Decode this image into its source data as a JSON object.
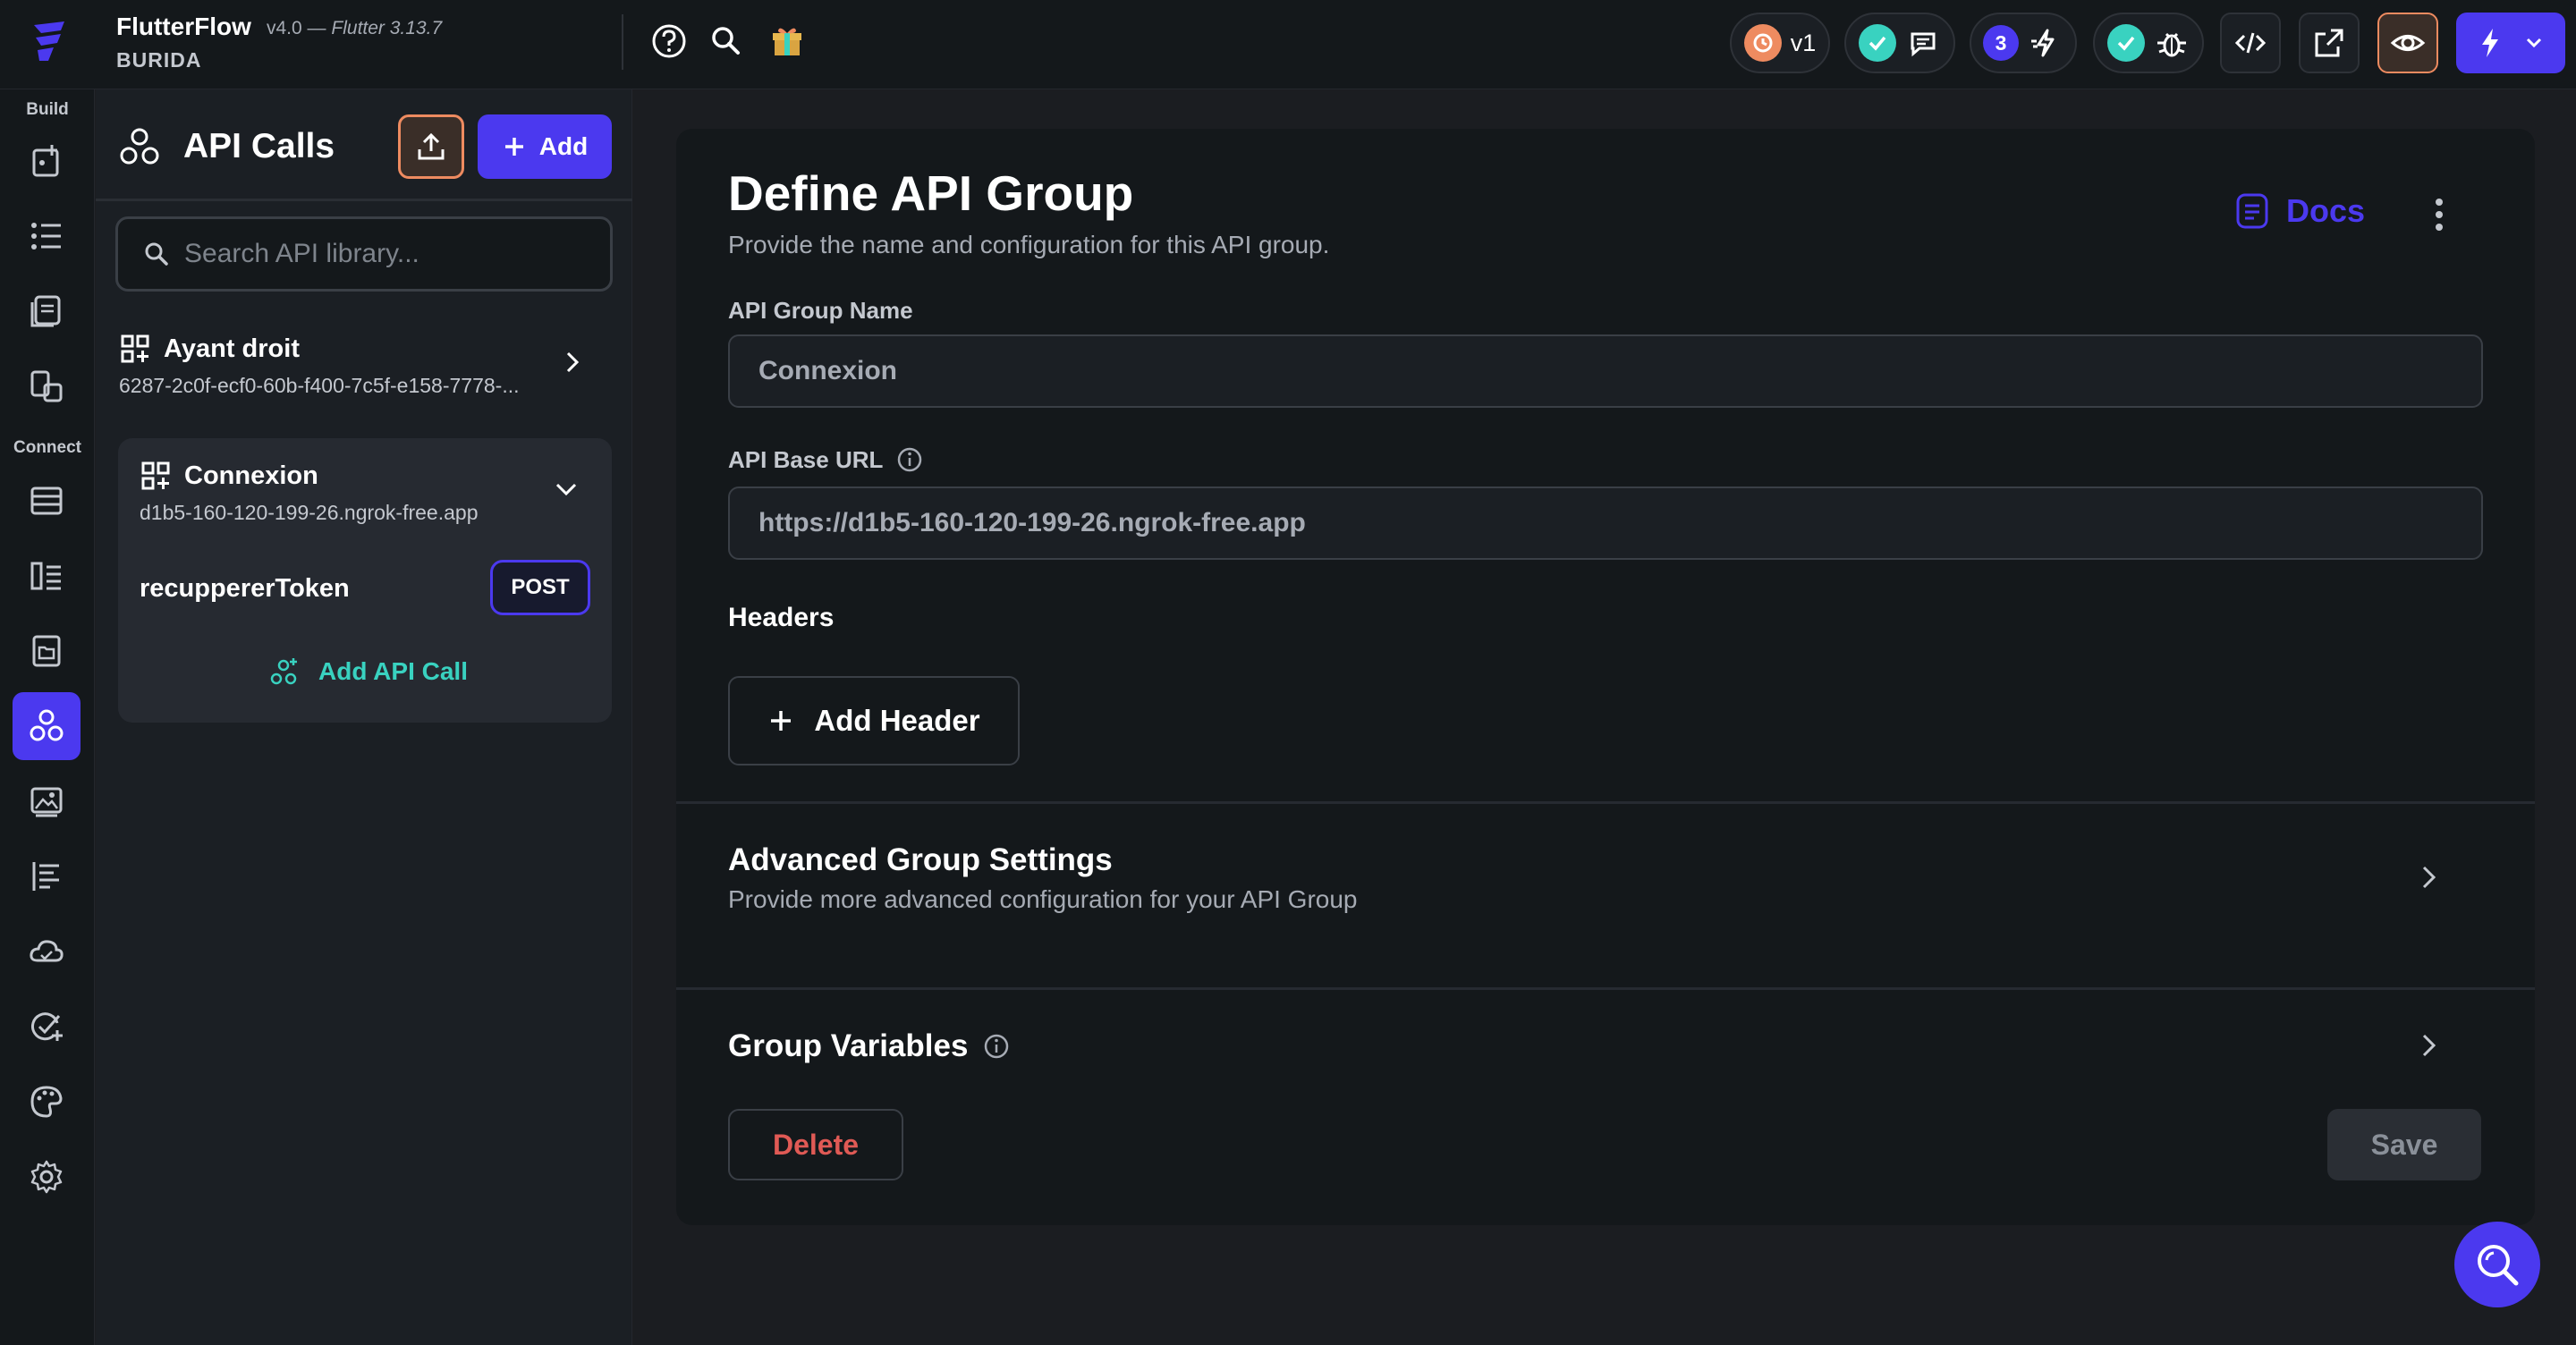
{
  "app": {
    "name": "FlutterFlow",
    "version": "v4.0",
    "version_separator": "—",
    "flutter_version": "Flutter 3.13.7",
    "project_name": "BURIDA"
  },
  "topbar": {
    "branch_label": "v1",
    "notification_count": "3",
    "icons": [
      "help-icon",
      "search-icon",
      "gift-icon",
      "history-icon",
      "check-icon",
      "comment-icon",
      "flash-icon",
      "bug-icon",
      "code-icon",
      "external-link-icon",
      "eye-icon",
      "bolt-icon",
      "chevron-down-icon"
    ]
  },
  "rail": {
    "build_label": "Build",
    "connect_label": "Connect"
  },
  "sidebar": {
    "title": "API Calls",
    "add_label": "Add",
    "search_placeholder": "Search API library...",
    "groups": [
      {
        "name": "Ayant droit",
        "subtitle": "6287-2c0f-ecf0-60b-f400-7c5f-e158-7778-..."
      },
      {
        "name": "Connexion",
        "subtitle": "d1b5-160-120-199-26.ngrok-free.app"
      }
    ],
    "calls": [
      {
        "name": "recuppererToken",
        "method": "POST"
      }
    ],
    "add_call_label": "Add API Call"
  },
  "main": {
    "title": "Define API Group",
    "subtitle": "Provide the name and configuration for this API group.",
    "docs_label": "Docs",
    "group_name_label": "API Group Name",
    "group_name_value": "Connexion",
    "base_url_label": "API Base URL",
    "base_url_value": "https://d1b5-160-120-199-26.ngrok-free.app",
    "headers_label": "Headers",
    "add_header_label": "Add Header",
    "advanced_title": "Advanced Group Settings",
    "advanced_subtitle": "Provide more advanced configuration for your API Group",
    "variables_title": "Group Variables",
    "delete_label": "Delete",
    "save_label": "Save"
  },
  "colors": {
    "primary": "#4b39ef",
    "secondary": "#39d2c0",
    "tertiary": "#ee8b60",
    "error": "#e05a55",
    "background": "#1b1d21"
  }
}
